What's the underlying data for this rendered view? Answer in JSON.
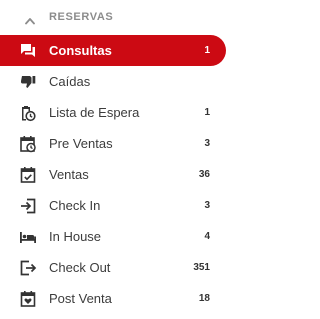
{
  "section": {
    "title": "RESERVAS",
    "chevron_icon": "chevron-up-icon"
  },
  "colors": {
    "active_bg": "#cc0a13",
    "active_text": "#ffffff",
    "text": "#3c3c3c",
    "icon": "#333333",
    "header_text": "#8c8c8c"
  },
  "items": [
    {
      "label": "Consultas",
      "count": "1",
      "icon": "chat-bubbles-icon",
      "active": true
    },
    {
      "label": "Caídas",
      "count": "",
      "icon": "thumbs-down-icon",
      "active": false
    },
    {
      "label": "Lista de Espera",
      "count": "1",
      "icon": "clipboard-clock-icon",
      "active": false
    },
    {
      "label": "Pre Ventas",
      "count": "3",
      "icon": "calendar-clock-icon",
      "active": false
    },
    {
      "label": "Ventas",
      "count": "36",
      "icon": "calendar-check-icon",
      "active": false
    },
    {
      "label": "Check In",
      "count": "3",
      "icon": "login-icon",
      "active": false
    },
    {
      "label": "In House",
      "count": "4",
      "icon": "bed-icon",
      "active": false
    },
    {
      "label": "Check Out",
      "count": "351",
      "icon": "logout-icon",
      "active": false
    },
    {
      "label": "Post Venta",
      "count": "18",
      "icon": "calendar-heart-icon",
      "active": false
    }
  ]
}
